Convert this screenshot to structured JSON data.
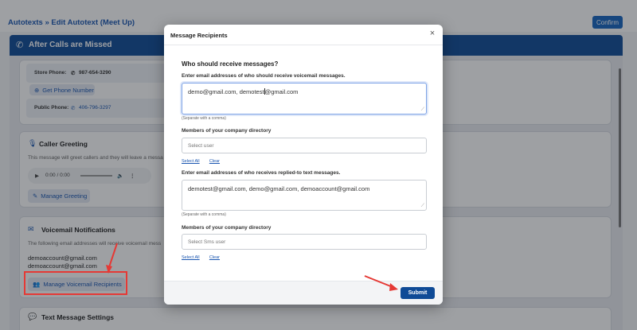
{
  "background": {
    "breadcrumb": "Autotexts » Edit Autotext (Meet Up)",
    "confirm_label": "Confirm",
    "section_title": "After Calls are Missed",
    "store_phone_label": "Store Phone:",
    "store_phone_value": "987-654-3290",
    "get_phone_label": "Get Phone Number",
    "public_phone_label": "Public Phone:",
    "public_phone_value": "406-796-3297",
    "caller_greeting_title": "Caller Greeting",
    "caller_greeting_desc": "This message will greet callers and they will leave a messa",
    "audio_time": "0:00 / 0:00",
    "manage_greeting_label": "Manage Greeting",
    "voicemail_title": "Voicemail Notifications",
    "voicemail_desc": "The following email addresses will receive voicemail mess",
    "voicemail_emails": [
      "demoaccount@gmail.com",
      "demoaccount@gmail.com"
    ],
    "manage_recipients_label": "Manage Voicemail Recipients",
    "text_settings_title": "Text Message Settings"
  },
  "modal": {
    "title": "Message Recipients",
    "close_symbol": "×",
    "question": "Who should receive messages?",
    "voicemail_email_label": "Enter email addresses of who should receive voicemail messages.",
    "voicemail_email_value_before_cursor": "demo@gmail.com, demotest",
    "voicemail_email_value_after_cursor": "@gmail.com",
    "separate_hint_1": "(Separate with a comma)",
    "directory_label_1": "Members of your company directory",
    "select_user_placeholder": "Select user",
    "select_all_1": "Select All",
    "clear_1": "Clear",
    "text_email_label": "Enter email addresses of who receives replied-to text messages.",
    "text_email_value": "demotest@gmail.com, demo@gmail.com, demoaccount@gmail.com",
    "separate_hint_2": "(Separate with a comma)",
    "directory_label_2": "Members of your company directory",
    "select_sms_placeholder": "Select Sms user",
    "select_all_2": "Select All",
    "clear_2": "Clear",
    "submit_label": "Submit"
  },
  "colors": {
    "brand_blue": "#0f4a96",
    "link_blue": "#1a56b0",
    "annotation_red": "#e53935"
  }
}
